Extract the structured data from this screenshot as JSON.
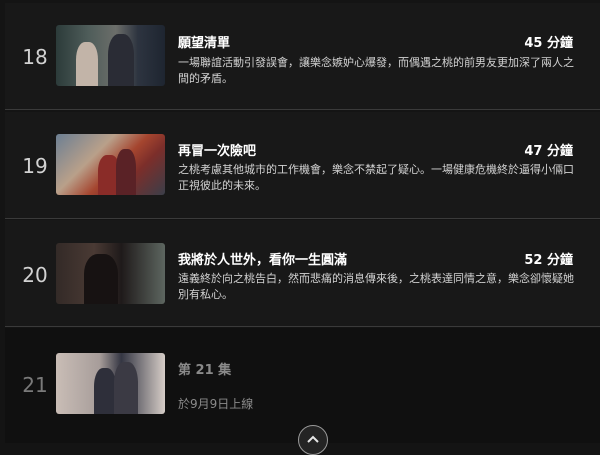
{
  "episodes": [
    {
      "number": "18",
      "title": "願望清單",
      "duration": "45 分鐘",
      "description": "一場聯誼活動引發誤會，讓樂念嫉妒心爆發，而偶遇之桃的前男友更加深了兩人之間的矛盾。"
    },
    {
      "number": "19",
      "title": "再冒一次險吧",
      "duration": "47 分鐘",
      "description": "之桃考慮其他城市的工作機會，樂念不禁起了疑心。一場健康危機終於逼得小倆口正視彼此的未來。"
    },
    {
      "number": "20",
      "title": "我將於人世外，看你一生圓滿",
      "duration": "52 分鐘",
      "description": "遠義終於向之桃告白，然而悲痛的消息傳來後，之桃表達同情之意，樂念卻懷疑她別有私心。"
    }
  ],
  "upcoming": {
    "number": "21",
    "title": "第 21 集",
    "release": "於9月9日上線"
  },
  "collapse_icon": "chevron-up-icon"
}
